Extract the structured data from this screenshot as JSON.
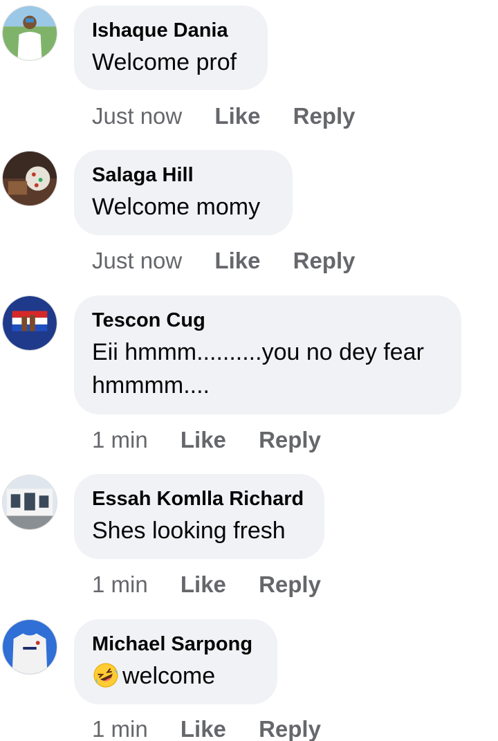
{
  "comments": [
    {
      "author": "Ishaque Dania",
      "text": "Welcome prof",
      "time": "Just now",
      "like": "Like",
      "reply": "Reply"
    },
    {
      "author": "Salaga Hill",
      "text": "Welcome momy",
      "time": "Just now",
      "like": "Like",
      "reply": "Reply"
    },
    {
      "author": "Tescon Cug",
      "text_line1": "Eii hmmm..........you no dey fear",
      "text_line2": "hmmmm....",
      "time": "1 min",
      "like": "Like",
      "reply": "Reply"
    },
    {
      "author": "Essah Komlla Richard",
      "text": "Shes looking fresh",
      "time": "1 min",
      "like": "Like",
      "reply": "Reply"
    },
    {
      "author": "Michael Sarpong",
      "emoji": "rolling-on-floor-laughing-emoji",
      "text": "welcome",
      "time": "1 min",
      "like": "Like",
      "reply": "Reply"
    }
  ],
  "colors": {
    "bubble": "#f0f2f5",
    "meta_text": "#65676b",
    "body_text": "#050505"
  }
}
